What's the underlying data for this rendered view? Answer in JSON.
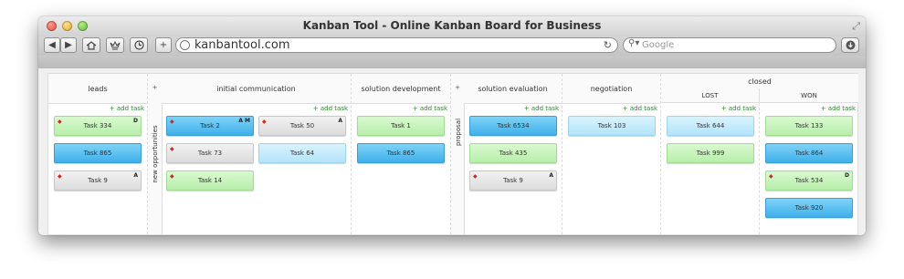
{
  "window": {
    "title": "Kanban Tool - Online Kanban Board for Business"
  },
  "toolbar": {
    "url": "kanbantool.com",
    "search_placeholder": "Google",
    "back": "◀",
    "forward": "▶",
    "new_tab": "+",
    "reload": "↻"
  },
  "board": {
    "add_task": "+ add task",
    "collapse_plus": "+",
    "columns": {
      "leads": "leads",
      "new_opportunities": "new opportunities",
      "initial_communication": "initial communication",
      "solution_development": "solution development",
      "proposal": "proposal",
      "solution_evaluation": "solution evaluation",
      "negotiation": "negotiation",
      "closed": "closed",
      "lost": "LOST",
      "won": "WON"
    },
    "cards": {
      "leads": [
        "Task 334",
        "Task 865",
        "Task 9"
      ],
      "leads_badges": [
        "D",
        "",
        "A"
      ],
      "initial_a": [
        "Task 2",
        "Task 73",
        "Task 14"
      ],
      "initial_a_badges": [
        "A M",
        "",
        ""
      ],
      "initial_b": [
        "Task 50",
        "Task 64"
      ],
      "initial_b_badges": [
        "A",
        ""
      ],
      "solution_development": [
        "Task 1",
        "Task 865"
      ],
      "solution_evaluation": [
        "Task 6534",
        "Task 435",
        "Task 9"
      ],
      "solution_evaluation_badges": [
        "",
        "",
        "A"
      ],
      "negotiation": [
        "Task 103"
      ],
      "lost": [
        "Task 644",
        "Task 999"
      ],
      "won": [
        "Task 133",
        "Task 864",
        "Task 534",
        "Task 920"
      ],
      "won_badges": [
        "",
        "",
        "D",
        ""
      ]
    }
  }
}
